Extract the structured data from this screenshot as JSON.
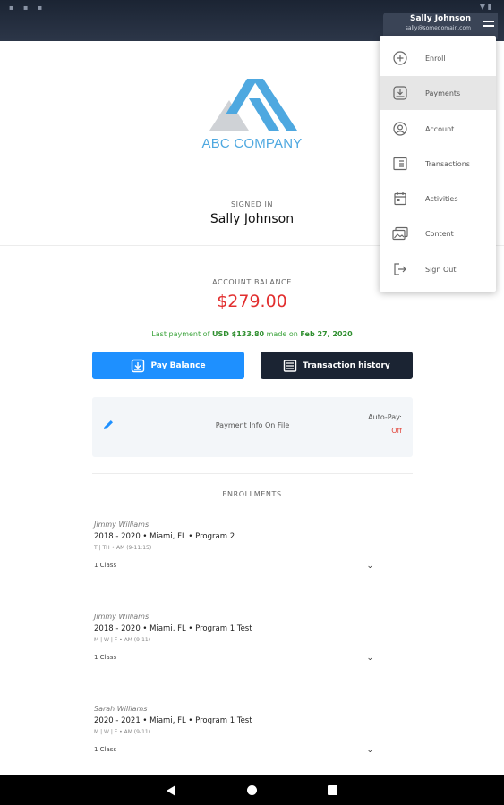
{
  "header": {
    "user_name": "Sally Johnson",
    "user_email": "sally@somedomain.com"
  },
  "logo": {
    "company_name": "ABC COMPANY",
    "colors": {
      "blue": "#4ea8e0",
      "grey": "#cfd2d6"
    }
  },
  "signed_in": {
    "label": "SIGNED IN",
    "name": "Sally Johnson"
  },
  "account": {
    "label": "ACCOUNT BALANCE",
    "balance": "$279.00",
    "balance_color": "#e22f2f",
    "last_payment_prefix": "Last payment of",
    "last_payment_amount": "USD $133.80",
    "last_payment_mid": "made on",
    "last_payment_date": "Feb 27, 2020"
  },
  "buttons": {
    "pay_balance": "Pay Balance",
    "transaction_history": "Transaction history"
  },
  "payment_info": {
    "label": "Payment Info On File",
    "auto_pay_label": "Auto-Pay:",
    "auto_pay_value": "Off"
  },
  "enrollments": {
    "title": "ENROLLMENTS",
    "items": [
      {
        "student": "Jimmy Williams",
        "program": "2018 - 2020 • Miami, FL • Program 2",
        "schedule": "T | TH • AM (9-11:15)",
        "classes": "1 Class"
      },
      {
        "student": "Jimmy Williams",
        "program": "2018 - 2020 • Miami, FL • Program 1 Test",
        "schedule": "M | W | F • AM (9-11)",
        "classes": "1 Class"
      },
      {
        "student": "Sarah Williams",
        "program": "2020 - 2021 • Miami, FL • Program 1 Test",
        "schedule": "M | W | F • AM (9-11)",
        "classes": "1 Class"
      }
    ]
  },
  "menu": {
    "items": [
      {
        "label": "Enroll",
        "icon": "plus-circle-icon"
      },
      {
        "label": "Payments",
        "icon": "payments-icon",
        "active": true
      },
      {
        "label": "Account",
        "icon": "account-icon"
      },
      {
        "label": "Transactions",
        "icon": "transactions-list-icon"
      },
      {
        "label": "Activities",
        "icon": "calendar-icon"
      },
      {
        "label": "Content",
        "icon": "images-icon"
      },
      {
        "label": "Sign Out",
        "icon": "sign-out-icon"
      }
    ]
  }
}
